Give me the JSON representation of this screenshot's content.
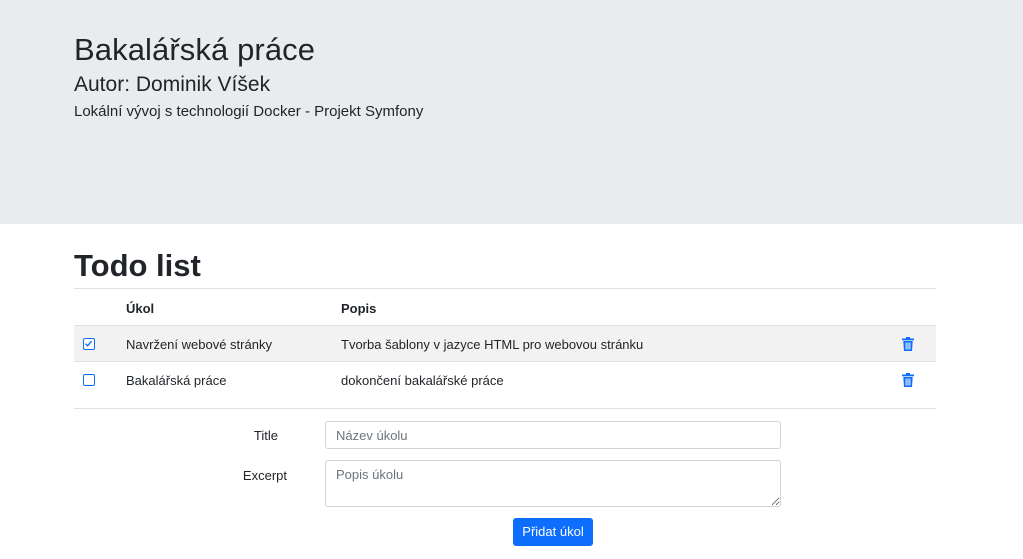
{
  "header": {
    "title": "Bakalářská práce",
    "author": "Autor: Dominik Víšek",
    "subtitle": "Lokální vývoj s technologií Docker - Projekt Symfony"
  },
  "todo": {
    "heading": "Todo list",
    "columns": {
      "task": "Úkol",
      "description": "Popis"
    },
    "items": [
      {
        "checked": true,
        "task": "Navržení webové stránky",
        "description": "Tvorba šablony v jazyce HTML pro webovou stránku",
        "icon": "trash-icon"
      },
      {
        "checked": false,
        "task": "Bakalářská práce",
        "description": "dokončení bakalářské práce",
        "icon": "trash-icon"
      }
    ]
  },
  "form": {
    "title_label": "Title",
    "title_placeholder": "Název úkolu",
    "excerpt_label": "Excerpt",
    "excerpt_placeholder": "Popis úkolu",
    "submit_label": "Přidat úkol"
  },
  "colors": {
    "accent": "#0d6efd",
    "header_bg": "#e9ecef",
    "striped_row": "#f2f2f2"
  }
}
